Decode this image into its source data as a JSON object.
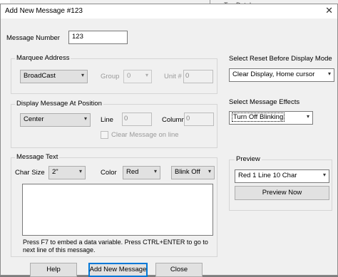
{
  "background_window": {
    "text": "Tag Database"
  },
  "dialog": {
    "title": "Add New Message #123",
    "close_glyph": "✕"
  },
  "message_number": {
    "label": "Message Number",
    "value": "123"
  },
  "marquee_address": {
    "group_title": "Marquee Address",
    "address_value": "BroadCast",
    "group_label": "Group",
    "group_value": "0",
    "unit_label": "Unit #",
    "unit_value": "0"
  },
  "display_position": {
    "group_title": "Display Message At Position",
    "position_value": "Center",
    "line_label": "Line",
    "line_value": "0",
    "column_label": "Column",
    "column_value": "0",
    "clear_label": "Clear Message on line"
  },
  "message_text": {
    "group_title": "Message Text",
    "char_size_label": "Char Size",
    "char_size_value": "2\"",
    "color_label": "Color",
    "color_value": "Red",
    "blink_value": "Blink Off",
    "text_value": "",
    "hint_line1": "Press F7 to embed a data variable.  Press CTRL+ENTER to go to",
    "hint_line2": "next line of this message."
  },
  "reset_mode": {
    "label": "Select Reset Before Display Mode",
    "value": "Clear Display, Home cursor"
  },
  "effects": {
    "label": "Select Message Effects",
    "value": "Turn Off Blinking"
  },
  "preview": {
    "group_title": "Preview",
    "value": "Red 1 Line 10 Char",
    "button": "Preview Now"
  },
  "buttons": {
    "help": "Help",
    "add": "Add New Message",
    "close": "Close"
  },
  "icons": {
    "dropdown": "▾"
  }
}
